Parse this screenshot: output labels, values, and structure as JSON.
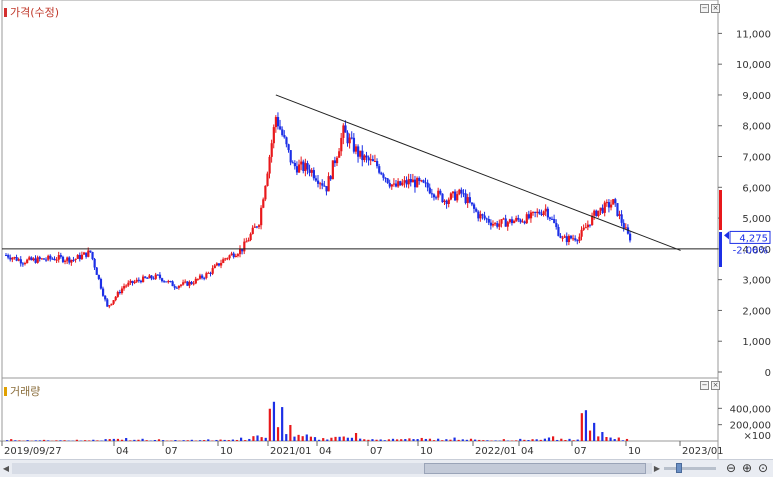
{
  "price_pane": {
    "title": "가격(수정)"
  },
  "volume_pane": {
    "title": "거래량",
    "unit": "×100"
  },
  "price_axis": {
    "labels": [
      "11,000",
      "10,000",
      "9,000",
      "8,000",
      "7,000",
      "6,000",
      "5,000",
      "4,000",
      "3,000",
      "2,000",
      "1,000",
      "0"
    ]
  },
  "volume_axis": {
    "labels": [
      "400,000",
      "200,000"
    ]
  },
  "x_axis": {
    "labels": [
      "2019/09/27",
      "04",
      "07",
      "10",
      "2021/01",
      "04",
      "07",
      "10",
      "2022/01",
      "04",
      "07",
      "10",
      "2023/01"
    ]
  },
  "current": {
    "price": "4,275",
    "change": "-2.06%"
  },
  "colors": {
    "up": "#e8181b",
    "down": "#1c2fe6",
    "line": "#222222",
    "axis": "#666666"
  },
  "icons": [
    "zoom-out-icon",
    "zoom-in-icon",
    "zoom-reset-icon"
  ],
  "chart_data": [
    {
      "type": "candlestick",
      "title": "가격(수정)",
      "ylim": [
        0,
        11500
      ],
      "ticks": [
        0,
        1000,
        2000,
        3000,
        4000,
        5000,
        6000,
        7000,
        8000,
        9000,
        10000,
        11000
      ],
      "x_labels": [
        "2019/09/27",
        "04",
        "07",
        "10",
        "2021/01",
        "04",
        "07",
        "10",
        "2022/01",
        "04",
        "07",
        "10",
        "2023/01"
      ],
      "series": [
        {
          "date": "2019-09",
          "close": 3800
        },
        {
          "date": "2019-10",
          "close": 3600
        },
        {
          "date": "2019-11",
          "close": 3650
        },
        {
          "date": "2019-12",
          "close": 3700
        },
        {
          "date": "2020-01",
          "close": 3650
        },
        {
          "date": "2020-02",
          "close": 3900
        },
        {
          "date": "2020-03",
          "close": 2100
        },
        {
          "date": "2020-04",
          "close": 2800
        },
        {
          "date": "2020-05",
          "close": 3000
        },
        {
          "date": "2020-06",
          "close": 3100
        },
        {
          "date": "2020-07",
          "close": 2800
        },
        {
          "date": "2020-08",
          "close": 2900
        },
        {
          "date": "2020-09",
          "close": 3200
        },
        {
          "date": "2020-10",
          "close": 3700
        },
        {
          "date": "2020-11",
          "close": 4000
        },
        {
          "date": "2020-12",
          "close": 4900
        },
        {
          "date": "2021-01",
          "close": 8300
        },
        {
          "date": "2021-02",
          "close": 6700
        },
        {
          "date": "2021-03",
          "close": 6600
        },
        {
          "date": "2021-04",
          "close": 6000
        },
        {
          "date": "2021-05",
          "close": 7800
        },
        {
          "date": "2021-06",
          "close": 7000
        },
        {
          "date": "2021-07",
          "close": 6700
        },
        {
          "date": "2021-08",
          "close": 6000
        },
        {
          "date": "2021-09",
          "close": 6200
        },
        {
          "date": "2021-10",
          "close": 6000
        },
        {
          "date": "2021-11",
          "close": 5600
        },
        {
          "date": "2021-12",
          "close": 5800
        },
        {
          "date": "2022-01",
          "close": 5100
        },
        {
          "date": "2022-02",
          "close": 4800
        },
        {
          "date": "2022-03",
          "close": 4900
        },
        {
          "date": "2022-04",
          "close": 5000
        },
        {
          "date": "2022-05",
          "close": 5300
        },
        {
          "date": "2022-06",
          "close": 4300
        },
        {
          "date": "2022-07",
          "close": 4400
        },
        {
          "date": "2022-08",
          "close": 5200
        },
        {
          "date": "2022-09",
          "close": 5500
        },
        {
          "date": "2022-10",
          "close": 4275
        }
      ],
      "hlines": [
        4000
      ],
      "trendline": {
        "from": {
          "date": "2021-01",
          "value": 9000
        },
        "to": {
          "date": "2023-01",
          "value": 3950
        }
      },
      "last_price": 4275,
      "last_change": "-2.06%"
    },
    {
      "type": "bar",
      "title": "거래량",
      "unit": "×100",
      "ticks": [
        200000,
        400000
      ],
      "ylim": [
        0,
        600000
      ],
      "values": [
        20000,
        15000,
        12000,
        18000,
        14000,
        25000,
        40000,
        30000,
        22000,
        18000,
        15000,
        16000,
        20000,
        28000,
        35000,
        95000,
        600000,
        250000,
        90000,
        60000,
        140000,
        80000,
        50000,
        40000,
        45000,
        38000,
        30000,
        35000,
        28000,
        22000,
        20000,
        25000,
        45000,
        60000,
        30000,
        480000,
        90000,
        40000
      ],
      "up": [
        false,
        true,
        false,
        true,
        false,
        true,
        false,
        true,
        true,
        false,
        true,
        true,
        true,
        true,
        true,
        true,
        true,
        false,
        true,
        false,
        true,
        false,
        true,
        false,
        true,
        false,
        true,
        true,
        false,
        true,
        false,
        true,
        true,
        false,
        true,
        true,
        true,
        false
      ]
    }
  ]
}
